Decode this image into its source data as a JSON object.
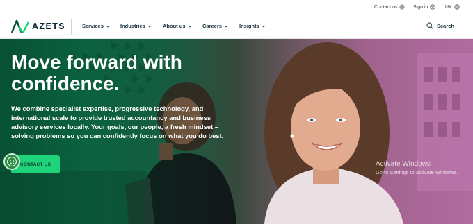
{
  "utility": {
    "contact": "Contact us",
    "signin": "Sign in",
    "region": "UK"
  },
  "nav": {
    "brand": "AZETS",
    "items": [
      "Services",
      "Industries",
      "About us",
      "Careers",
      "Insights"
    ],
    "search": "Search"
  },
  "hero": {
    "headline": "Move forward with confidence.",
    "body": "We combine specialist expertise, progressive technology, and international scale to provide trusted accountancy and business advisory services locally. Your goals, our people, a fresh mindset – solving problems so you can confidently focus on what you do best.",
    "cta": "CONTACT US"
  },
  "watermark": {
    "line1": "Activate Windows",
    "line2": "Go to Settings to activate Windows."
  },
  "colors": {
    "brand_green": "#1fd37a",
    "cookie_green": "#2f8a47"
  }
}
